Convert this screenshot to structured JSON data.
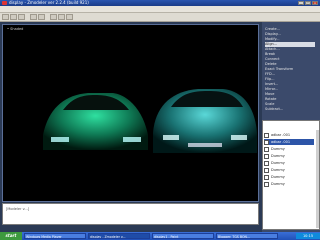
{
  "window": {
    "title": "display - Zmodeler ver 2.2.4 (build 921)"
  },
  "viewport": {
    "label": "• Shaded"
  },
  "command": {
    "prompt": "[Modeler v...]"
  },
  "panel": {
    "items": [
      "Create...",
      "Display...",
      "Modify...",
      "Align...",
      "Attach...",
      "Break",
      "Connect",
      "Delete",
      "Exact Transform",
      "FFD...",
      "Flip...",
      "Insert...",
      "Mirror...",
      "Move",
      "Rotate",
      "Scale",
      "Subtract..."
    ]
  },
  "layers": {
    "rows": [
      "adbar .001",
      "adbar .001",
      "Dummy",
      "Dummy",
      "Dummy",
      "Dummy",
      "Dummy",
      "Dummy"
    ]
  },
  "taskbar": {
    "start": "start",
    "tasks": [
      "Windows Media Player",
      "display - Zmodeler v...",
      "display1 - Paint",
      "Blogger: TGS BON..."
    ],
    "clock": "10:15"
  }
}
